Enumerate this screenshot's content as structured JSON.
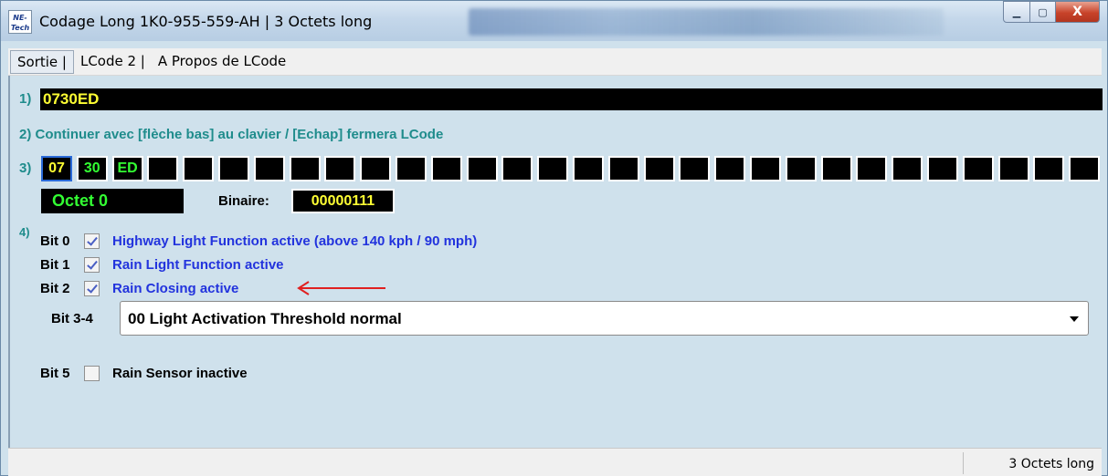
{
  "window": {
    "title": "Codage Long  1K0-955-559-AH | 3 Octets long",
    "icon_text": "NE-Tech",
    "min_glyph": "▁",
    "max_glyph": "▢",
    "close_glyph": "X"
  },
  "menu": [
    {
      "label": "Sortie |"
    },
    {
      "label": "LCode 2 |"
    },
    {
      "label": "A Propos de LCode"
    }
  ],
  "step1": {
    "label": "1)",
    "hex": "0730ED"
  },
  "step2": {
    "label": "2) Continuer avec [flèche bas] au clavier / [Echap] fermera LCode"
  },
  "step3": {
    "label": "3)",
    "bytes": [
      "07",
      "30",
      "ED",
      "",
      "",
      "",
      "",
      "",
      "",
      "",
      "",
      "",
      "",
      "",
      "",
      "",
      "",
      "",
      "",
      "",
      "",
      "",
      "",
      "",
      "",
      "",
      "",
      "",
      "",
      ""
    ],
    "byte_colors": [
      "#ffff33",
      "#33ff33",
      "#33ff33"
    ]
  },
  "octet": {
    "label": "Octet 0",
    "binary_label": "Binaire:",
    "binary_value": "00000111"
  },
  "step4": {
    "label": "4)"
  },
  "bits": [
    {
      "label": "Bit 0",
      "checked": true,
      "text": "Highway Light Function active (above 140 kph / 90 mph)"
    },
    {
      "label": "Bit 1",
      "checked": true,
      "text": "Rain Light Function active"
    },
    {
      "label": "Bit 2",
      "checked": true,
      "text": "Rain Closing active"
    }
  ],
  "bit34": {
    "label": "Bit 3-4",
    "selected": "00 Light Activation Threshold normal"
  },
  "bit5": {
    "label": "Bit 5",
    "checked": false,
    "text": "Rain Sensor inactive"
  },
  "status": {
    "text": "3 Octets long"
  },
  "colors": {
    "background": "#cfe1ec",
    "hex_text": "#ffff33",
    "green_text": "#33ff33",
    "teal": "#1f8c8c",
    "bit_blue": "#2233dd",
    "annotation_red": "#e02020"
  }
}
